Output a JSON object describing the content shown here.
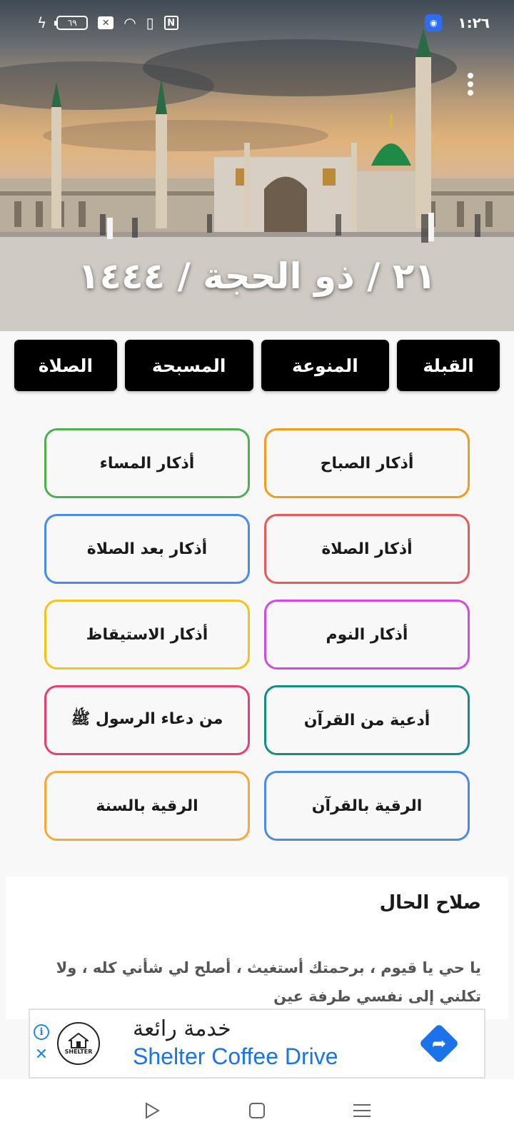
{
  "status_bar": {
    "battery": "٦٩",
    "time": "١:٢٦"
  },
  "header": {
    "date": "٢١ / ذو الحجة / ١٤٤٤"
  },
  "tabs": [
    {
      "label": "القبلة"
    },
    {
      "label": "المنوعة"
    },
    {
      "label": "المسبحة"
    },
    {
      "label": "الصلاة"
    }
  ],
  "cards": [
    {
      "label": "أذكار الصباح",
      "color": "#f29b1c"
    },
    {
      "label": "أذكار المساء",
      "color": "#4caf50"
    },
    {
      "label": "أذكار الصلاة",
      "color": "#e85a5a"
    },
    {
      "label": "أذكار بعد الصلاة",
      "color": "#4a8ae8"
    },
    {
      "label": "أذكار النوم",
      "color": "#d44ae0"
    },
    {
      "label": "أذكار الاستيقاظ",
      "color": "#f2c318"
    },
    {
      "label": "أدعية من القرآن",
      "color": "#12907c"
    },
    {
      "label": "من دعاء الرسول ﷺ",
      "color": "#e83f73"
    },
    {
      "label": "الرقية بالقرآن",
      "color": "#4a8ae8"
    },
    {
      "label": "الرقية بالسنة",
      "color": "#f7a83a"
    }
  ],
  "wisdom": {
    "title": "صلاح الحال",
    "text": "يا حي يا قيوم ، برحمتك أستغيث ، أصلح لي شأني كله ، ولا تكلني إلى نفسي طرفة عين"
  },
  "ad": {
    "title": "خدمة رائعة",
    "subtitle": "Shelter Coffee Drive",
    "logo_text": "SHELTER",
    "accent": "#1a73e8"
  },
  "icons": {
    "info": "i",
    "close": "✕",
    "more": "more-vert-icon",
    "go": "directions-icon"
  }
}
